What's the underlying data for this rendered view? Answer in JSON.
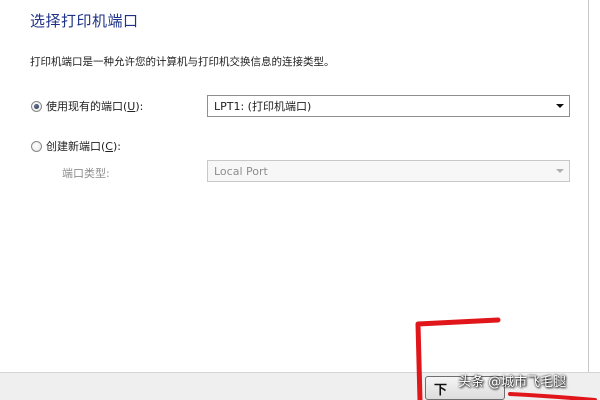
{
  "title": "选择打印机端口",
  "description": "打印机端口是一种允许您的计算机与打印机交换信息的连接类型。",
  "use_existing": {
    "label": "使用现有的端口(",
    "accel": "U",
    "suffix": "):",
    "checked": true,
    "selected_port": "LPT1: (打印机端口)"
  },
  "create_new": {
    "label": "创建新端口(",
    "accel": "C",
    "suffix": "):",
    "checked": false,
    "port_type_label": "端口类型:",
    "port_type_value": "Local Port"
  },
  "footer": {
    "next_label": "下"
  },
  "annotation": {
    "color": "#e0161b"
  },
  "watermark": "头条 @城市飞毛腿"
}
